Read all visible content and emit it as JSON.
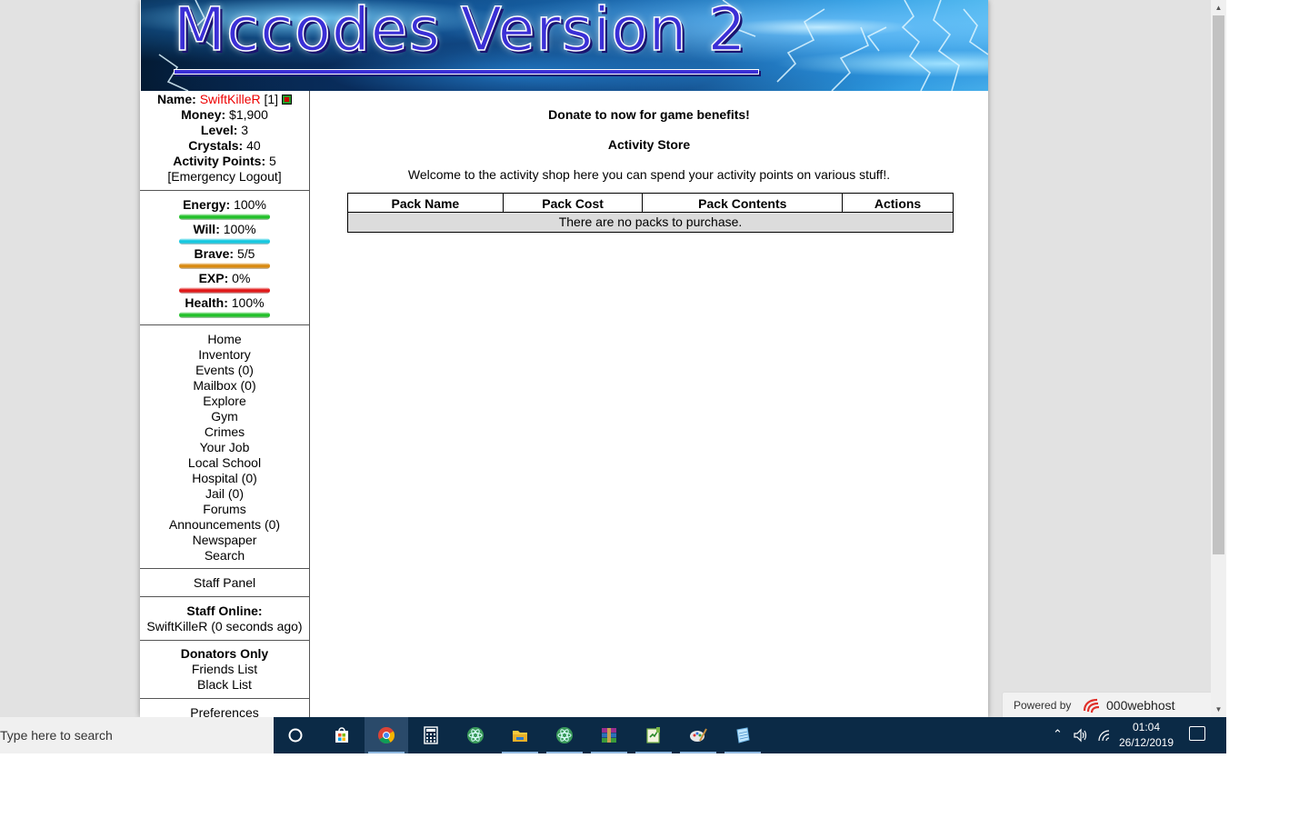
{
  "banner": {
    "title": "Mccodes Version 2"
  },
  "user": {
    "name_label": "Name:",
    "name": "SwiftKilleR",
    "id": "[1]",
    "money_label": "Money:",
    "money": "$1,900",
    "level_label": "Level:",
    "level": "3",
    "crystals_label": "Crystals:",
    "crystals": "40",
    "activity_label": "Activity Points:",
    "activity": "5",
    "logout": "[Emergency Logout]"
  },
  "bars": [
    {
      "label": "Energy:",
      "value": "100%",
      "color": "#22c02a",
      "fraction": 1.0
    },
    {
      "label": "Will:",
      "value": "100%",
      "color": "#16c8e0",
      "fraction": 1.0
    },
    {
      "label": "Brave:",
      "value": "5/5",
      "color": "#d98a10",
      "fraction": 1.0
    },
    {
      "label": "EXP:",
      "value": "0%",
      "color": "#e01818",
      "fraction": 0.0
    },
    {
      "label": "Health:",
      "value": "100%",
      "color": "#22c02a",
      "fraction": 1.0
    }
  ],
  "nav": [
    "Home",
    "Inventory",
    "Events (0)",
    "Mailbox (0)",
    "Explore",
    "Gym",
    "Crimes",
    "Your Job",
    "Local School",
    "Hospital (0)",
    "Jail (0)",
    "Forums",
    "Announcements (0)",
    "Newspaper",
    "Search"
  ],
  "staff_panel": "Staff Panel",
  "staff_online": {
    "title": "Staff Online:",
    "entry": "SwiftKilleR (0 seconds ago)"
  },
  "donators": {
    "title": "Donators Only",
    "links": [
      "Friends List",
      "Black List"
    ]
  },
  "preferences": "Preferences",
  "content": {
    "donate": "Donate to now for game benefits!",
    "store_title": "Activity Store",
    "welcome": "Welcome to the activity shop here you can spend your activity points on various stuff!.",
    "table_headers": [
      "Pack Name",
      "Pack Cost",
      "Pack Contents",
      "Actions"
    ],
    "empty_message": "There are no packs to purchase."
  },
  "powered_by": {
    "label": "Powered by",
    "brand": "000webhost"
  },
  "taskbar": {
    "search_placeholder": "Type here to search",
    "icons": [
      "cortana-icon",
      "store-icon",
      "chrome-icon",
      "calculator-icon",
      "atom-icon",
      "file-explorer-icon",
      "atom-icon",
      "winrar-icon",
      "notepad-plus-icon",
      "paint-icon",
      "notepad-icon"
    ],
    "time": "01:04",
    "date": "26/12/2019"
  }
}
